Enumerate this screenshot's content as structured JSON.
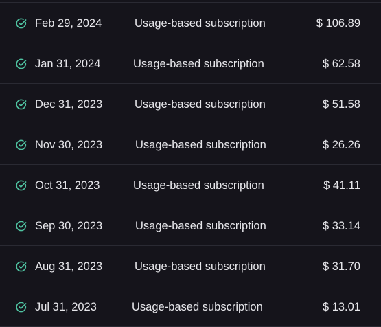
{
  "icons": {
    "status": "check-circle-icon",
    "status_color": "#4fc3a1"
  },
  "invoices": [
    {
      "date": "Feb 29, 2024",
      "description": "Usage-based subscription",
      "amount": "$ 106.89"
    },
    {
      "date": "Jan 31, 2024",
      "description": "Usage-based subscription",
      "amount": "$ 62.58"
    },
    {
      "date": "Dec 31, 2023",
      "description": "Usage-based subscription",
      "amount": "$ 51.58"
    },
    {
      "date": "Nov 30, 2023",
      "description": "Usage-based subscription",
      "amount": "$ 26.26"
    },
    {
      "date": "Oct 31, 2023",
      "description": "Usage-based subscription",
      "amount": "$ 41.11"
    },
    {
      "date": "Sep 30, 2023",
      "description": "Usage-based subscription",
      "amount": "$ 33.14"
    },
    {
      "date": "Aug 31, 2023",
      "description": "Usage-based subscription",
      "amount": "$ 31.70"
    },
    {
      "date": "Jul 31, 2023",
      "description": "Usage-based subscription",
      "amount": "$ 13.01"
    }
  ]
}
